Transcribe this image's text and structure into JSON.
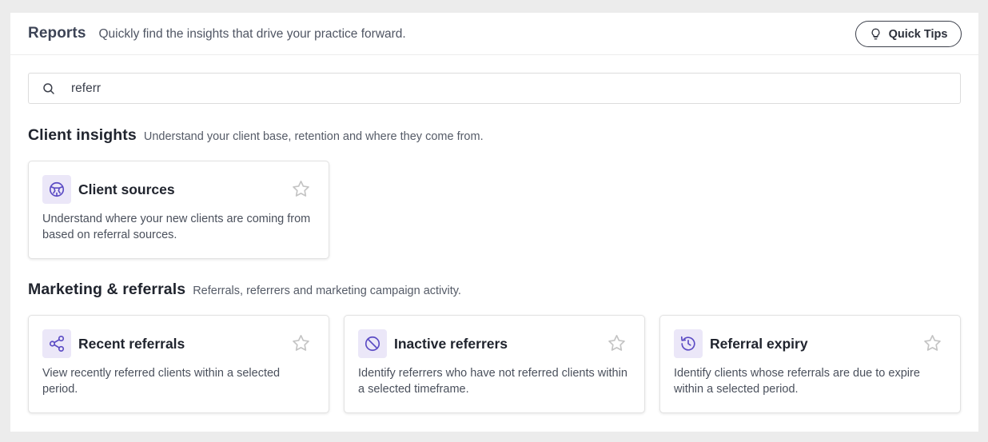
{
  "header": {
    "title": "Reports",
    "subtitle": "Quickly find the insights that drive your practice forward.",
    "quick_tips_label": "Quick Tips"
  },
  "search": {
    "value": "referr",
    "icon": "search-icon"
  },
  "sections": [
    {
      "title": "Client insights",
      "description": "Understand your client base, retention and where they come from.",
      "cards": [
        {
          "title": "Client sources",
          "description": "Understand where your new clients are coming from based on referral sources.",
          "icon": "globe-icon"
        }
      ]
    },
    {
      "title": "Marketing & referrals",
      "description": "Referrals, referrers and marketing campaign activity.",
      "cards": [
        {
          "title": "Recent referrals",
          "description": "View recently referred clients within a selected period.",
          "icon": "share-icon"
        },
        {
          "title": "Inactive referrers",
          "description": "Identify referrers who have not referred clients within a selected timeframe.",
          "icon": "ban-icon"
        },
        {
          "title": "Referral expiry",
          "description": "Identify clients whose referrals are due to expire within a selected period.",
          "icon": "history-icon"
        }
      ]
    }
  ],
  "colors": {
    "accent": "#5b4bc4",
    "icon_bg": "#ebe7f8",
    "star": "#c4c4c4"
  }
}
